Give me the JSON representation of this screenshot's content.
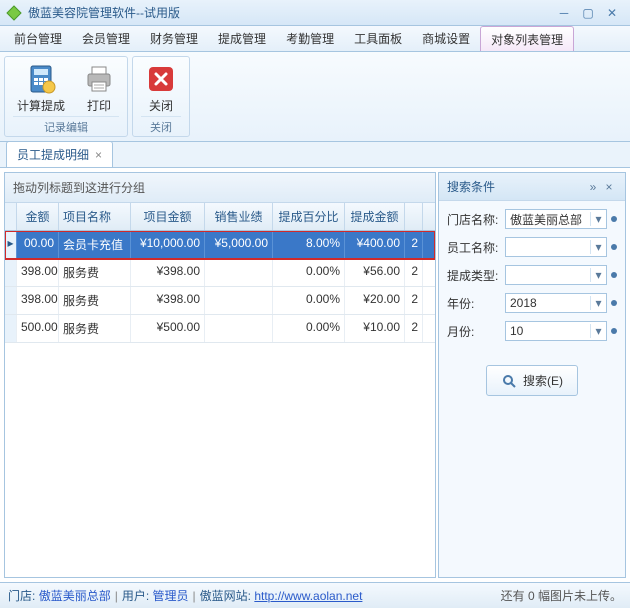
{
  "title": "傲蓝美容院管理软件--试用版",
  "menus": [
    "前台管理",
    "会员管理",
    "财务管理",
    "提成管理",
    "考勤管理",
    "工具面板",
    "商城设置",
    "对象列表管理"
  ],
  "active_menu": 7,
  "ribbon": {
    "group1": {
      "btn1": "计算提成",
      "btn2": "打印",
      "label": "记录编辑"
    },
    "group2": {
      "btn1": "关闭",
      "label": "关闭"
    }
  },
  "tab": {
    "label": "员工提成明细"
  },
  "group_drop": "拖动列标题到这进行分组",
  "headers": [
    "金额",
    "项目名称",
    "项目金额",
    "销售业绩",
    "提成百分比",
    "提成金额"
  ],
  "rows": [
    {
      "amt": "00.00",
      "name": "会员卡充值",
      "pamt": "¥10,000.00",
      "sales": "¥5,000.00",
      "pct": "8.00%",
      "comm": "¥400.00",
      "last": "2"
    },
    {
      "amt": "398.00",
      "name": "服务费",
      "pamt": "¥398.00",
      "sales": "",
      "pct": "0.00%",
      "comm": "¥56.00",
      "last": "2"
    },
    {
      "amt": "398.00",
      "name": "服务费",
      "pamt": "¥398.00",
      "sales": "",
      "pct": "0.00%",
      "comm": "¥20.00",
      "last": "2"
    },
    {
      "amt": "500.00",
      "name": "服务费",
      "pamt": "¥500.00",
      "sales": "",
      "pct": "0.00%",
      "comm": "¥10.00",
      "last": "2"
    }
  ],
  "search": {
    "title": "搜索条件",
    "store_label": "门店名称:",
    "store_value": "傲蓝美丽总部",
    "emp_label": "员工名称:",
    "emp_value": "",
    "type_label": "提成类型:",
    "type_value": "",
    "year_label": "年份:",
    "year_value": "2018",
    "month_label": "月份:",
    "month_value": "10",
    "button": "搜索(E)"
  },
  "status": {
    "store_label": "门店:",
    "store": "傲蓝美丽总部",
    "user_label": "用户:",
    "user": "管理员",
    "site_label": "傲蓝网站:",
    "site_url": "http://www.aolan.net",
    "upload": "还有 0 幅图片未上传。"
  }
}
